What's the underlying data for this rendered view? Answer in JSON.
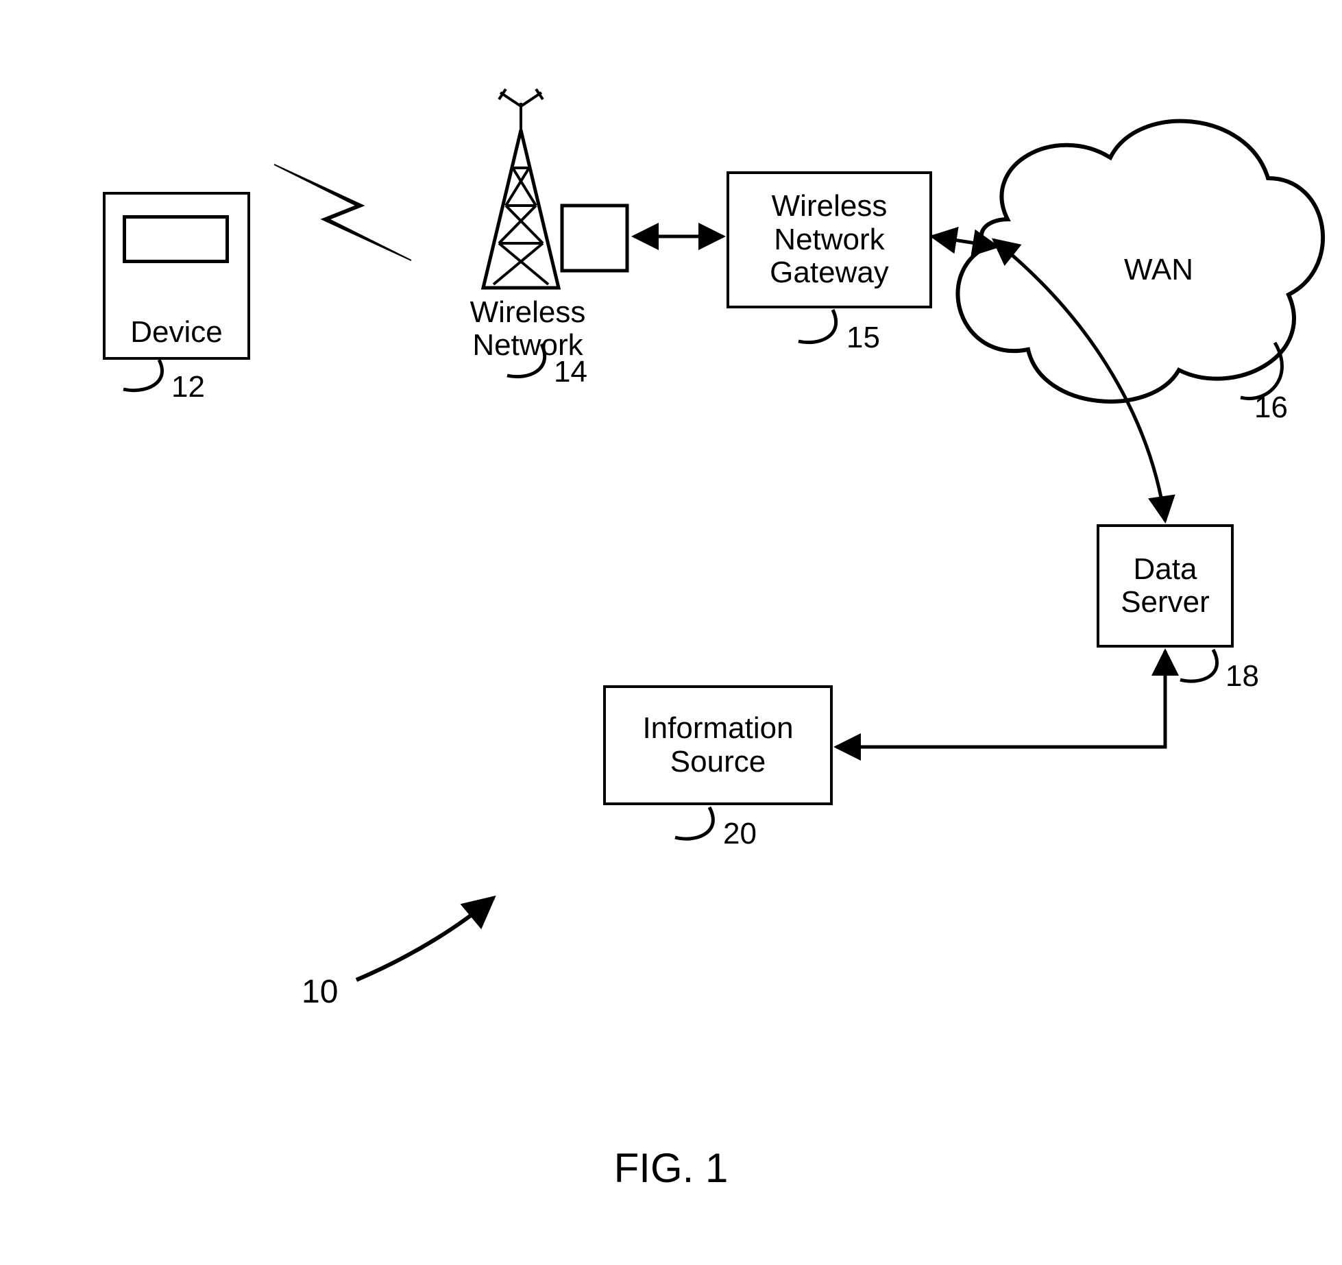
{
  "diagram_id": "10",
  "figure_label": "FIG. 1",
  "nodes": {
    "device": {
      "label": "Device",
      "ref": "12"
    },
    "wireless_net": {
      "label": "Wireless\nNetwork",
      "ref": "14"
    },
    "gateway": {
      "label": "Wireless\nNetwork\nGateway",
      "ref": "15"
    },
    "wan": {
      "label": "WAN",
      "ref": "16"
    },
    "data_server": {
      "label": "Data\nServer",
      "ref": "18"
    },
    "info_source": {
      "label": "Information\nSource",
      "ref": "20"
    }
  }
}
